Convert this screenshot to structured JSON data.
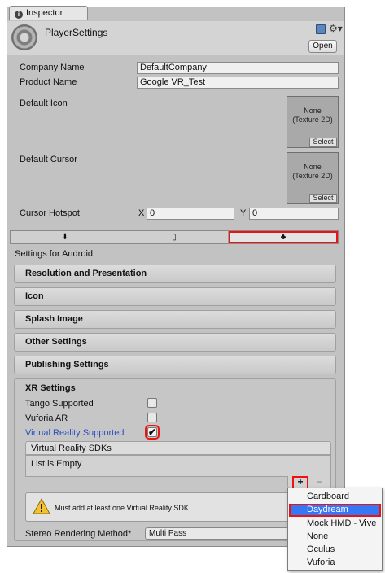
{
  "tab": {
    "title": "Inspector"
  },
  "header": {
    "title": "PlayerSettings",
    "open_label": "Open"
  },
  "fields": {
    "company_label": "Company Name",
    "company_value": "DefaultCompany",
    "product_label": "Product Name",
    "product_value": "Google VR_Test",
    "icon_label": "Default Icon",
    "cursor_label": "Default Cursor",
    "texture_none": "None",
    "texture_type": "(Texture 2D)",
    "select_label": "Select",
    "hotspot_label": "Cursor Hotspot",
    "x_label": "X",
    "x_value": "0",
    "y_label": "Y",
    "y_value": "0"
  },
  "platform_tabs": [
    {
      "icon": "download-icon",
      "selected": false
    },
    {
      "icon": "phone-icon",
      "selected": false
    },
    {
      "icon": "android-icon",
      "selected": true
    }
  ],
  "settings_for": "Settings for Android",
  "sections": [
    "Resolution and Presentation",
    "Icon",
    "Splash Image",
    "Other Settings",
    "Publishing Settings"
  ],
  "xr": {
    "title": "XR Settings",
    "tango_label": "Tango Supported",
    "tango_checked": false,
    "vuforia_label": "Vuforia AR",
    "vuforia_checked": false,
    "vr_label": "Virtual Reality Supported",
    "vr_checked": true,
    "sdks_header": "Virtual Reality SDKs",
    "sdks_empty": "List is Empty",
    "add_label": "+",
    "remove_label": "−",
    "warning": "Must add at least one Virtual Reality SDK.",
    "stereo_label": "Stereo Rendering Method*",
    "stereo_value": "Multi Pass"
  },
  "popup": {
    "items": [
      "Cardboard",
      "Daydream",
      "Mock HMD - Vive",
      "None",
      "Oculus",
      "Vuforia"
    ],
    "highlighted": "Daydream"
  },
  "colors": {
    "highlight": "#3478f6",
    "annotation_red": "#e11111",
    "link_blue": "#2a4fc0"
  }
}
